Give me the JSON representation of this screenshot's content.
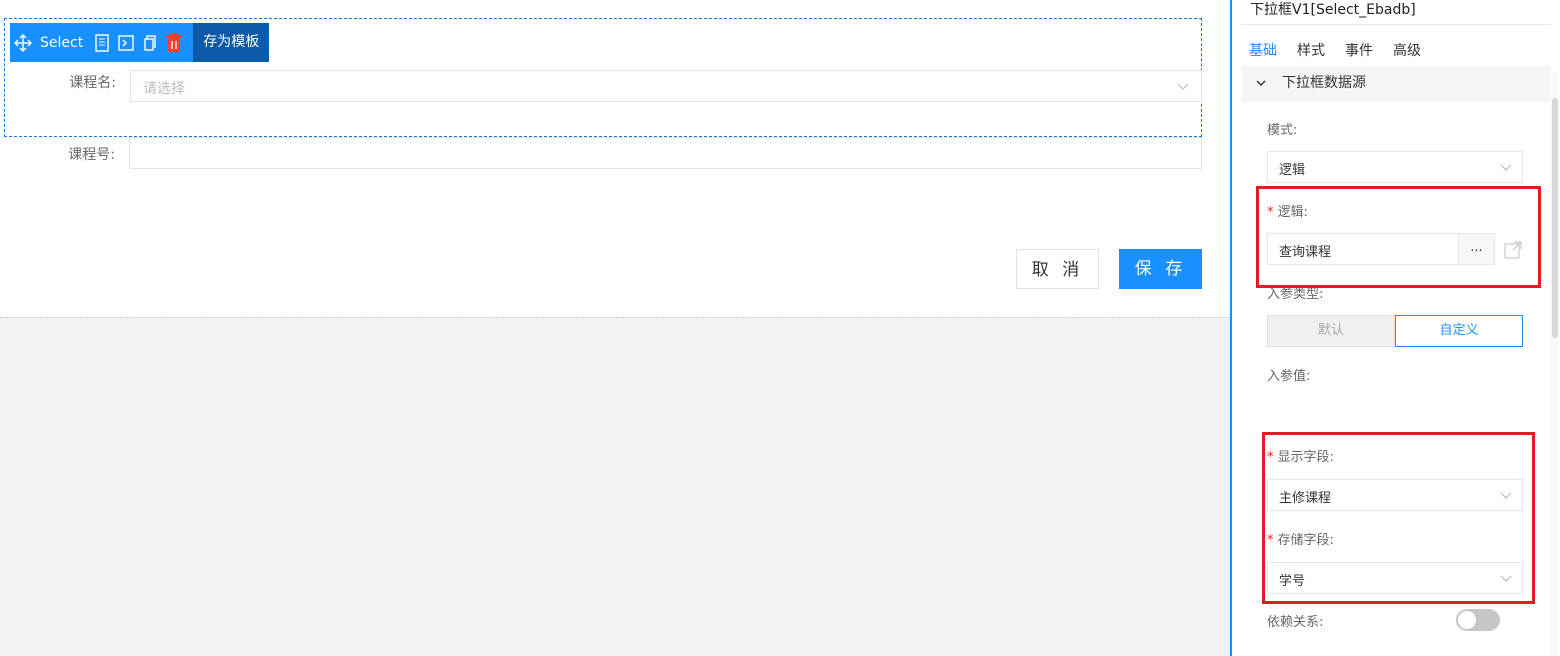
{
  "toolbar": {
    "move_icon": "move-arrows-icon",
    "component_label": "Select",
    "icons": [
      "document-icon",
      "terminal-icon",
      "copy-icon",
      "trash-icon"
    ],
    "save_template_label": "存为模板"
  },
  "form": {
    "course_name_label": "课程名:",
    "course_name_placeholder": "请选择",
    "course_no_label": "课程号:",
    "cancel_label": "取 消",
    "save_label": "保 存"
  },
  "panel": {
    "title": "下拉框V1[Select_Ebadb]",
    "tabs": [
      "基础",
      "样式",
      "事件",
      "高级"
    ],
    "active_tab": "基础",
    "section_title": "下拉框数据源",
    "mode_label": "模式:",
    "mode_value": "逻辑",
    "logic_label": "逻辑:",
    "logic_value": "查询课程",
    "logic_more": "...",
    "param_type_label": "入参类型:",
    "param_type_options": [
      "默认",
      "自定义"
    ],
    "param_type_selected": "自定义",
    "param_value_label": "入参值:",
    "display_field_label": "显示字段:",
    "display_field_value": "主修课程",
    "store_field_label": "存储字段:",
    "store_field_value": "学号",
    "dependency_label": "依赖关系:",
    "dependency_enabled": false
  },
  "colors": {
    "accent": "#1890ff",
    "toolbar_dark": "#0a5aa8",
    "highlight_red": "#e31b23",
    "canvas_bg": "#f0f2f5"
  }
}
